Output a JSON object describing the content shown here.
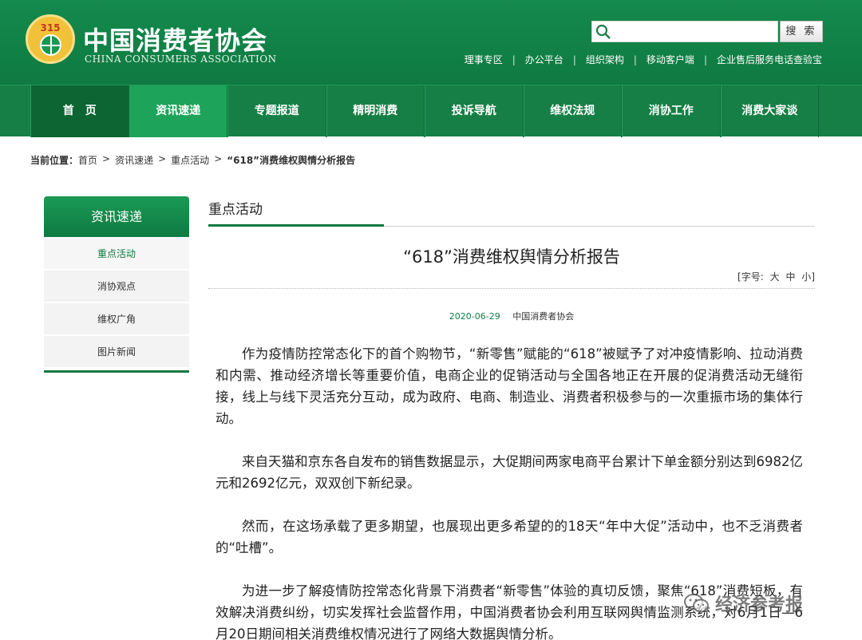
{
  "header": {
    "logo_number": "315",
    "org_name_cn": "中国消费者协会",
    "org_name_en": "CHINA CONSUMERS ASSOCIATION",
    "search": {
      "placeholder": "",
      "button_label": "搜 索"
    },
    "top_links": [
      "理事专区",
      "办公平台",
      "组织架构",
      "移动客户端",
      "企业售后服务电话查验宝"
    ],
    "colors": {
      "brand_green": "#0f7a41",
      "emblem_gold": "#f2c13a"
    }
  },
  "nav": {
    "items": [
      {
        "label": "首　页"
      },
      {
        "label": "资讯速递"
      },
      {
        "label": "专题报道"
      },
      {
        "label": "精明消费"
      },
      {
        "label": "投诉导航"
      },
      {
        "label": "维权法规"
      },
      {
        "label": "消协工作"
      },
      {
        "label": "消费大家谈"
      }
    ]
  },
  "breadcrumb": {
    "label": "当前位置：",
    "items": [
      "首页",
      "资讯速递",
      "重点活动",
      "“618”消费维权舆情分析报告"
    ],
    "separator": ">"
  },
  "sidebar": {
    "title": "资讯速递",
    "items": [
      {
        "label": "重点活动"
      },
      {
        "label": "消协观点"
      },
      {
        "label": "维权广角"
      },
      {
        "label": "图片新闻"
      }
    ]
  },
  "main": {
    "section_title": "重点活动",
    "article_title": "“618”消费维权舆情分析报告",
    "font_size": {
      "prefix": "[字号:",
      "large": "大",
      "medium": "中",
      "small": "小",
      "suffix": "]"
    },
    "date": "2020-06-29",
    "source": "中国消费者协会",
    "paragraphs": [
      "作为疫情防控常态化下的首个购物节，“新零售”赋能的“618”被赋予了对冲疫情影响、拉动消费和内需、推动经济增长等重要价值，电商企业的促销活动与全国各地正在开展的促消费活动无缝衔接，线上与线下灵活充分互动，成为政府、电商、制造业、消费者积极参与的一次重振市场的集体行动。",
      "来自天猫和京东各自发布的销售数据显示，大促期间两家电商平台累计下单金额分别达到6982亿元和2692亿元，双双创下新纪录。",
      "然而，在这场承载了更多期望，也展现出更多希望的的18天“年中大促”活动中，也不乏消费者的“吐槽”。",
      "为进一步了解疫情防控常态化背景下消费者“新零售”体验的真切反馈，聚焦“618”消费短板，有效解决消费纠纷，切实发挥社会监督作用，中国消费者协会利用互联网舆情监测系统，对6月1日—6月20日期间相关消费维权情况进行了网络大数据舆情分析。"
    ]
  },
  "watermark": {
    "text": "经济参考报",
    "icon": "wechat-icon"
  }
}
